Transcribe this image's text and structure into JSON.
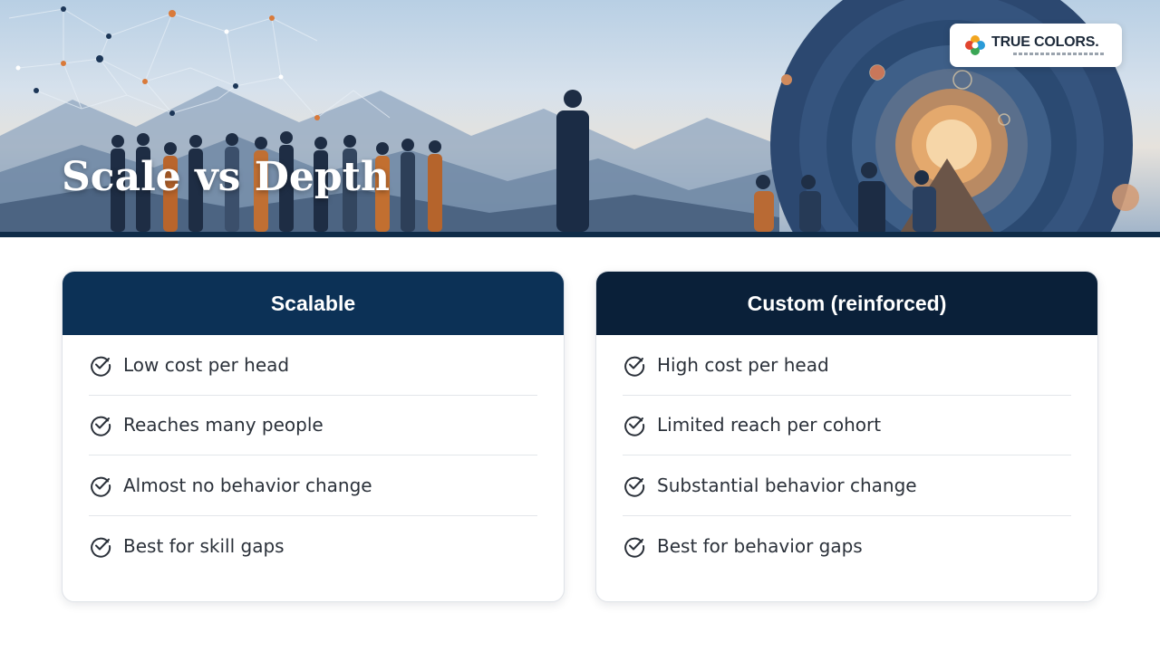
{
  "title": "Scale vs Depth",
  "logo": {
    "name": "TRUE COLORS."
  },
  "columns": [
    {
      "heading": "Scalable",
      "items": [
        "Low cost per head",
        "Reaches many people",
        "Almost no behavior change",
        "Best for skill gaps"
      ]
    },
    {
      "heading": "Custom (reinforced)",
      "items": [
        "High cost per head",
        "Limited reach per cohort",
        "Substantial behavior change",
        "Best for behavior gaps"
      ]
    }
  ],
  "icons": {
    "item": "check-circle-icon"
  },
  "colors": {
    "scalable_header": "#0c3156",
    "custom_header": "#0a2039",
    "banner_rule": "#0f2c48"
  }
}
